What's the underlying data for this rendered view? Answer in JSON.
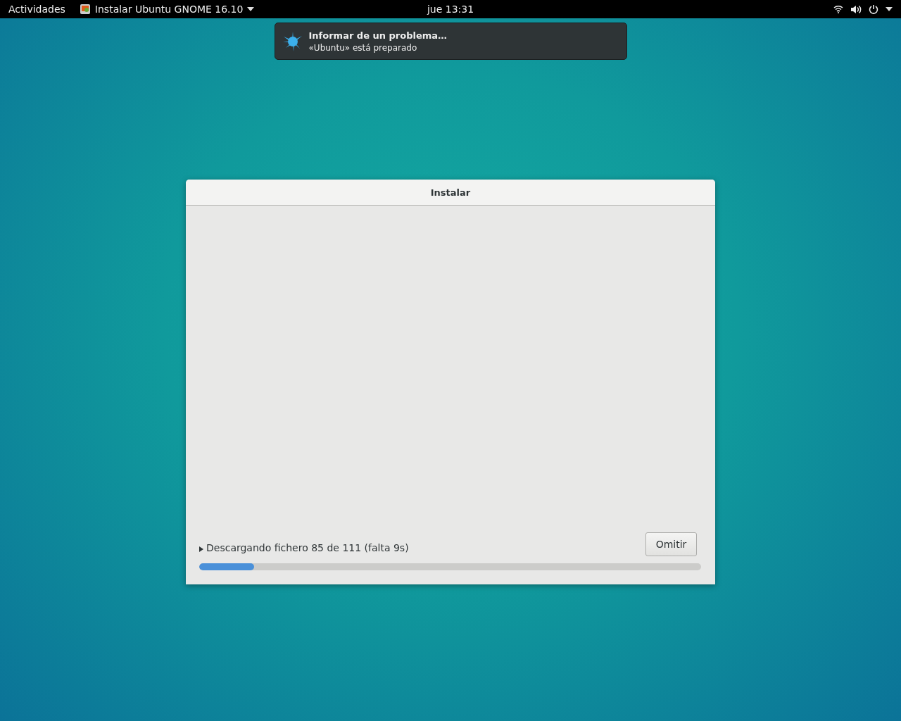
{
  "top_bar": {
    "activities": "Actividades",
    "app_menu": "Instalar Ubuntu GNOME 16.10",
    "clock": "jue 13:31"
  },
  "notification": {
    "title": "Informar de un problema…",
    "body": "«Ubuntu» está preparado"
  },
  "dialog": {
    "title": "Instalar",
    "details": {
      "label": "Descargando fichero 85 de 111 (falta 9s)",
      "expanded": false
    },
    "button": "Omitir",
    "progress": {
      "level": 0.11
    }
  }
}
